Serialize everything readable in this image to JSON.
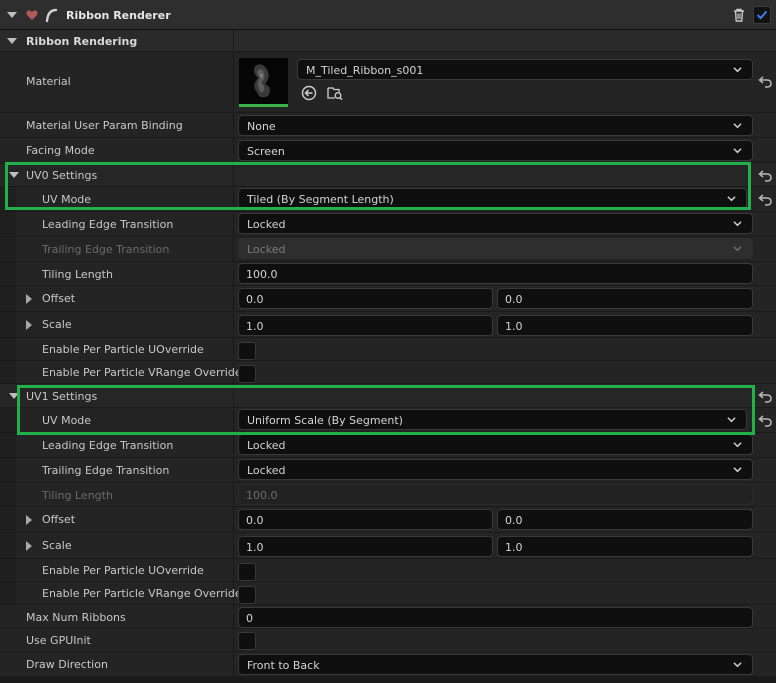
{
  "header": {
    "title": "Ribbon Renderer",
    "module_icon": "heart-shield-icon",
    "renderer_icon": "ribbon-curve-icon",
    "delete_icon": "trash-icon",
    "enabled": true,
    "accent_color": "#2f6fe0"
  },
  "category": {
    "label": "Ribbon Rendering"
  },
  "material": {
    "label": "Material",
    "value": "M_Tiled_Ribbon_s001",
    "browse_icon": "use-selected-arrow-icon",
    "find_icon": "browse-folder-search-icon"
  },
  "material_user_param_binding": {
    "label": "Material User Param Binding",
    "value": "None"
  },
  "facing_mode": {
    "label": "Facing Mode",
    "value": "Screen"
  },
  "uv0": {
    "label": "UV0 Settings",
    "uv_mode": {
      "label": "UV Mode",
      "value": "Tiled (By Segment Length)"
    },
    "leading_edge": {
      "label": "Leading Edge Transition",
      "value": "Locked"
    },
    "trailing_edge": {
      "label": "Trailing Edge Transition",
      "value": "Locked"
    },
    "tiling_length": {
      "label": "Tiling Length",
      "value": "100.0"
    },
    "offset": {
      "label": "Offset",
      "x": "0.0",
      "y": "0.0"
    },
    "scale": {
      "label": "Scale",
      "x": "1.0",
      "y": "1.0"
    },
    "enable_u_override": {
      "label": "Enable Per Particle UOverride",
      "checked": false
    },
    "enable_v_override": {
      "label": "Enable Per Particle VRange Override",
      "checked": false
    }
  },
  "uv1": {
    "label": "UV1 Settings",
    "uv_mode": {
      "label": "UV Mode",
      "value": "Uniform Scale (By Segment)"
    },
    "leading_edge": {
      "label": "Leading Edge Transition",
      "value": "Locked"
    },
    "trailing_edge": {
      "label": "Trailing Edge Transition",
      "value": "Locked"
    },
    "tiling_length": {
      "label": "Tiling Length",
      "value": "100.0"
    },
    "offset": {
      "label": "Offset",
      "x": "0.0",
      "y": "0.0"
    },
    "scale": {
      "label": "Scale",
      "x": "1.0",
      "y": "1.0"
    },
    "enable_u_override": {
      "label": "Enable Per Particle UOverride",
      "checked": false
    },
    "enable_v_override": {
      "label": "Enable Per Particle VRange Override",
      "checked": false
    }
  },
  "max_num_ribbons": {
    "label": "Max Num Ribbons",
    "value": "0"
  },
  "use_gpu_init": {
    "label": "Use GPUInit",
    "checked": false
  },
  "draw_direction": {
    "label": "Draw Direction",
    "value": "Front to Back"
  },
  "highlight_color": "#21b04a"
}
